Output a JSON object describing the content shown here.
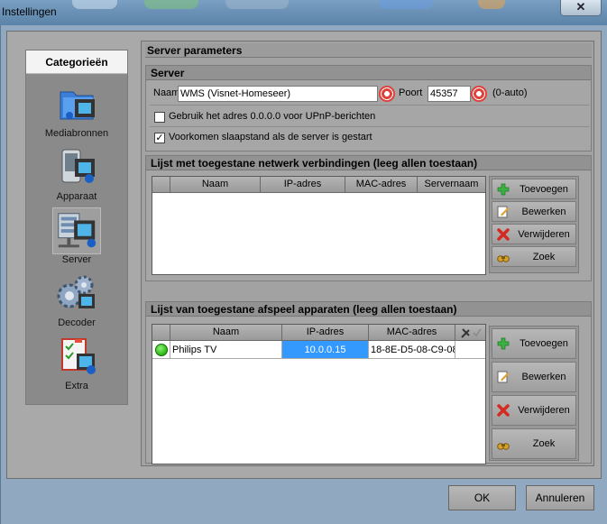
{
  "window": {
    "title": "Instellingen",
    "close_label": "✕"
  },
  "categories": {
    "header": "Categorieën",
    "items": [
      {
        "label": "Mediabronnen",
        "icon": "media-sources-icon"
      },
      {
        "label": "Apparaat",
        "icon": "device-icon"
      },
      {
        "label": "Server",
        "icon": "server-icon",
        "selected": true
      },
      {
        "label": "Decoder",
        "icon": "decoder-gears-icon"
      },
      {
        "label": "Extra",
        "icon": "extra-checklist-icon"
      }
    ]
  },
  "panel": {
    "title": "Server parameters"
  },
  "server": {
    "title": "Server",
    "name_label": "Naam",
    "name_value": "WMS (Visnet-Homeseer)",
    "port_label": "Poort",
    "port_value": "45357",
    "port_hint": "(0-auto)",
    "upnp_label": "Gebruik het adres 0.0.0.0 voor UPnP-berichten",
    "upnp_checked": false,
    "sleep_label": "Voorkomen  slaapstand als de server is gestart",
    "sleep_checked": true
  },
  "network": {
    "title": "Lijst met toegestane netwerk verbindingen (leeg allen toestaan)",
    "columns": [
      "Naam",
      "IP-adres",
      "MAC-adres",
      "Servernaam"
    ],
    "rows": []
  },
  "players": {
    "title": "Lijst van toegestane afspeel apparaten (leeg allen toestaan)",
    "columns": [
      "Naam",
      "IP-adres",
      "MAC-adres"
    ],
    "rows": [
      {
        "name": "Philips TV",
        "ip": "10.0.0.15",
        "mac": "18-8E-D5-08-C9-08",
        "status": "green"
      }
    ]
  },
  "buttons": {
    "add": "Toevoegen",
    "edit": "Bewerken",
    "delete": "Verwijderen",
    "search": "Zoek"
  },
  "footer": {
    "ok": "OK",
    "cancel": "Annuleren"
  },
  "colors": {
    "selection": "#3399ff",
    "status_green": "#34c11b"
  }
}
